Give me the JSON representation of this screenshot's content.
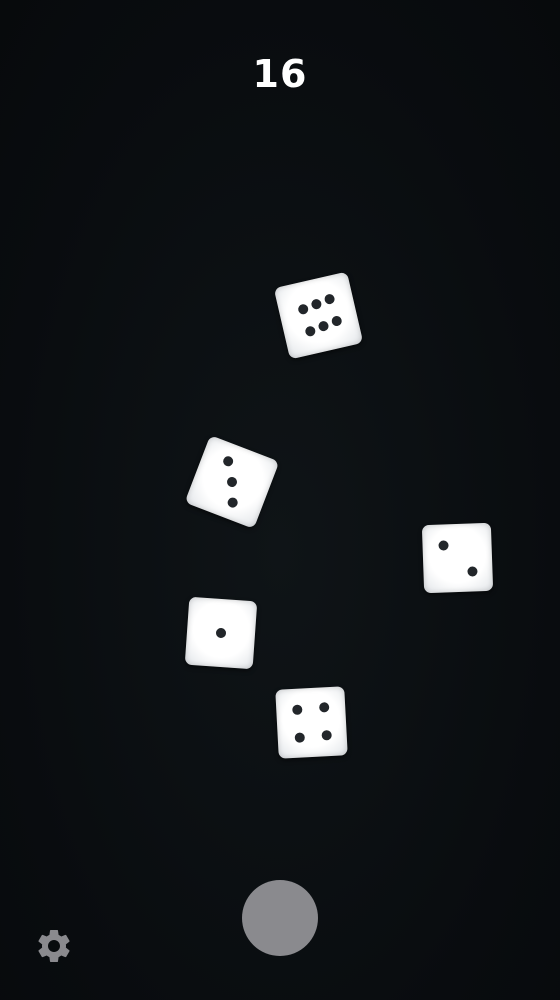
{
  "score": {
    "total": "16"
  },
  "dice": [
    {
      "value": 6
    },
    {
      "value": 3
    },
    {
      "value": 2
    },
    {
      "value": 1
    },
    {
      "value": 4
    }
  ],
  "controls": {
    "roll_button_icon": "circle-button",
    "settings_icon": "gear-icon"
  },
  "colors": {
    "background": "#0b0f12",
    "die_face": "#ffffff",
    "pip": "#22262a",
    "roll_button": "#8a8a8e",
    "settings_icon": "#8a8a8e"
  }
}
